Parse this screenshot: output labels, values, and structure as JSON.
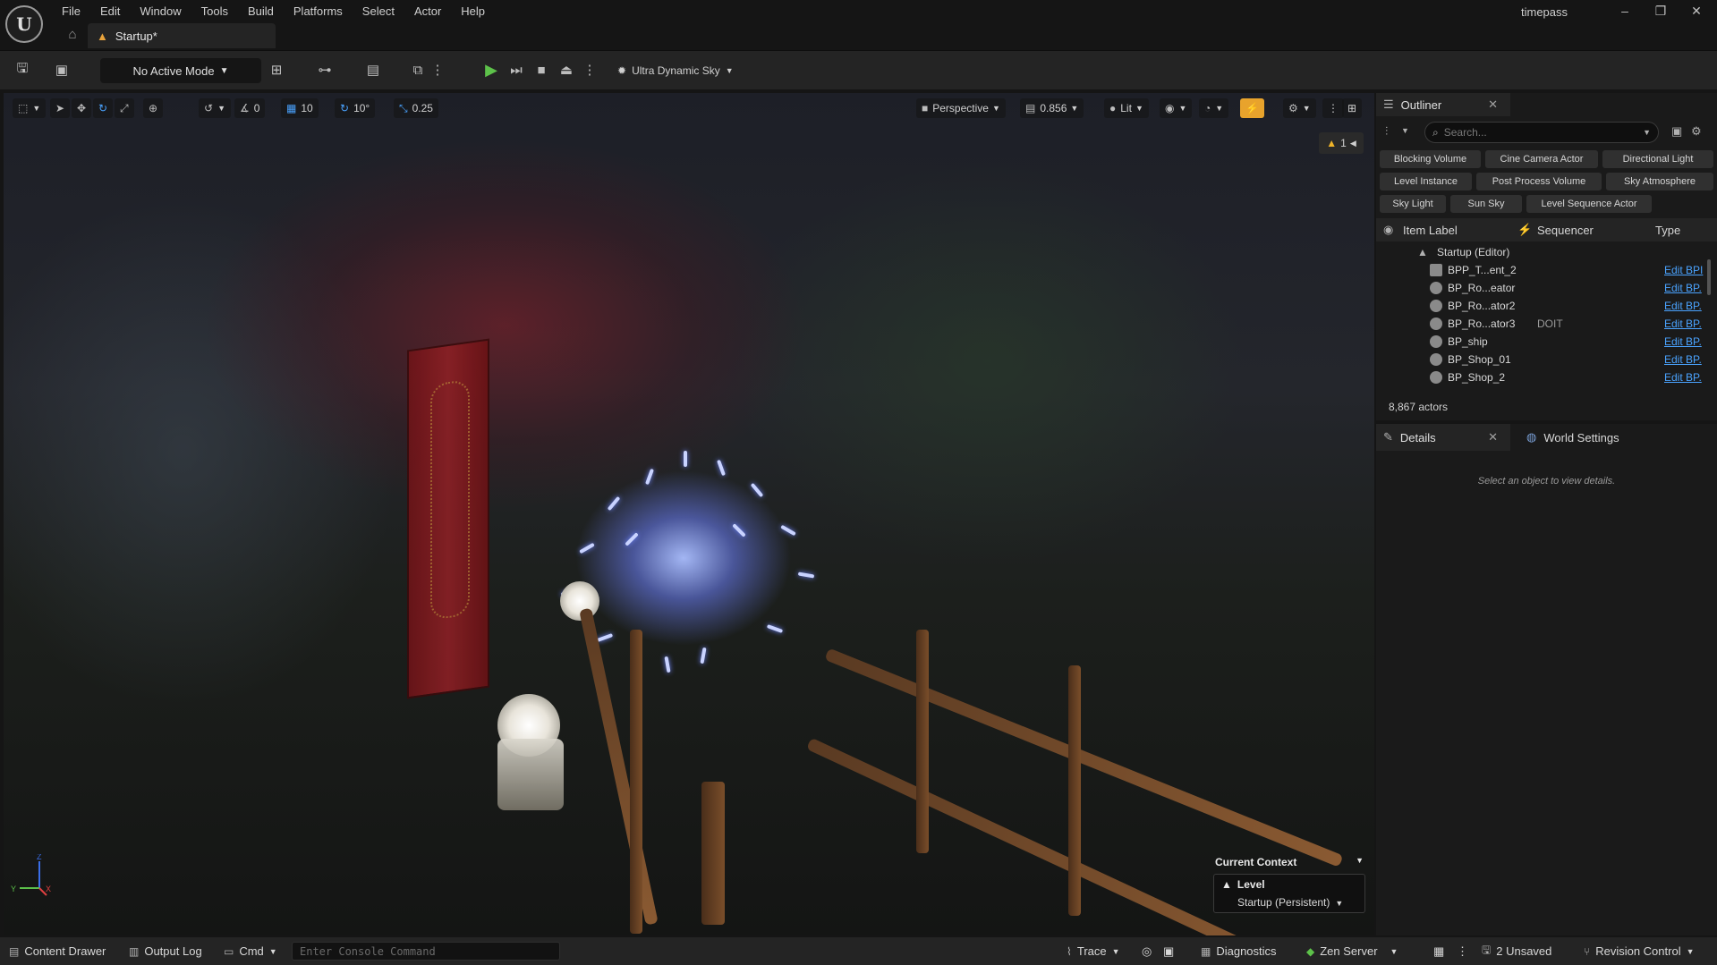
{
  "app": {
    "logo_text": "U",
    "project_name": "timepass",
    "document_tab": "Startup*"
  },
  "menu": [
    "File",
    "Edit",
    "Window",
    "Tools",
    "Build",
    "Platforms",
    "Select",
    "Actor",
    "Help"
  ],
  "toolbar": {
    "mode_label": "No Active Mode",
    "sky_label": "Ultra Dynamic Sky"
  },
  "viewport_toolbar": {
    "angle_snap_1": "0",
    "grid_snap": "10",
    "rotation_snap": "10°",
    "scale_snap": "0.25",
    "view_mode": "Perspective",
    "camera_speed": "0.856",
    "lighting": "Lit",
    "warnings_count": "1"
  },
  "gizmo": {
    "z": "Z",
    "y": "Y",
    "x": "X"
  },
  "current_context": {
    "title": "Current Context",
    "level_label": "Level",
    "level_value": "Startup (Persistent)"
  },
  "outliner": {
    "title": "Outliner",
    "search_placeholder": "Search...",
    "filters": [
      "Blocking Volume",
      "Cine Camera Actor",
      "Directional Light",
      "Level Instance",
      "Post Process Volume",
      "Sky Atmosphere",
      "Sky Light",
      "Sun Sky",
      "Level Sequence Actor"
    ],
    "columns": {
      "label": "Item Label",
      "sequencer": "Sequencer",
      "type": "Type"
    },
    "root": "Startup (Editor)",
    "rows": [
      {
        "name": "BPP_T...ent_2",
        "seq": "",
        "type": "Edit BPI"
      },
      {
        "name": "BP_Ro...eator",
        "seq": "",
        "type": "Edit BP."
      },
      {
        "name": "BP_Ro...ator2",
        "seq": "",
        "type": "Edit BP."
      },
      {
        "name": "BP_Ro...ator3",
        "seq": "DOIT",
        "type": "Edit BP."
      },
      {
        "name": "BP_ship",
        "seq": "",
        "type": "Edit BP."
      },
      {
        "name": "BP_Shop_01",
        "seq": "",
        "type": "Edit BP."
      },
      {
        "name": "BP_Shop_2",
        "seq": "",
        "type": "Edit BP."
      }
    ],
    "actor_count": "8,867 actors"
  },
  "details": {
    "title": "Details",
    "world_settings": "World Settings",
    "empty_message": "Select an object to view details."
  },
  "statusbar": {
    "content_drawer": "Content Drawer",
    "output_log": "Output Log",
    "cmd": "Cmd",
    "console_placeholder": "Enter Console Command",
    "trace": "Trace",
    "diagnostics": "Diagnostics",
    "zen_server": "Zen Server",
    "unsaved": "2 Unsaved",
    "revision_control": "Revision Control"
  }
}
